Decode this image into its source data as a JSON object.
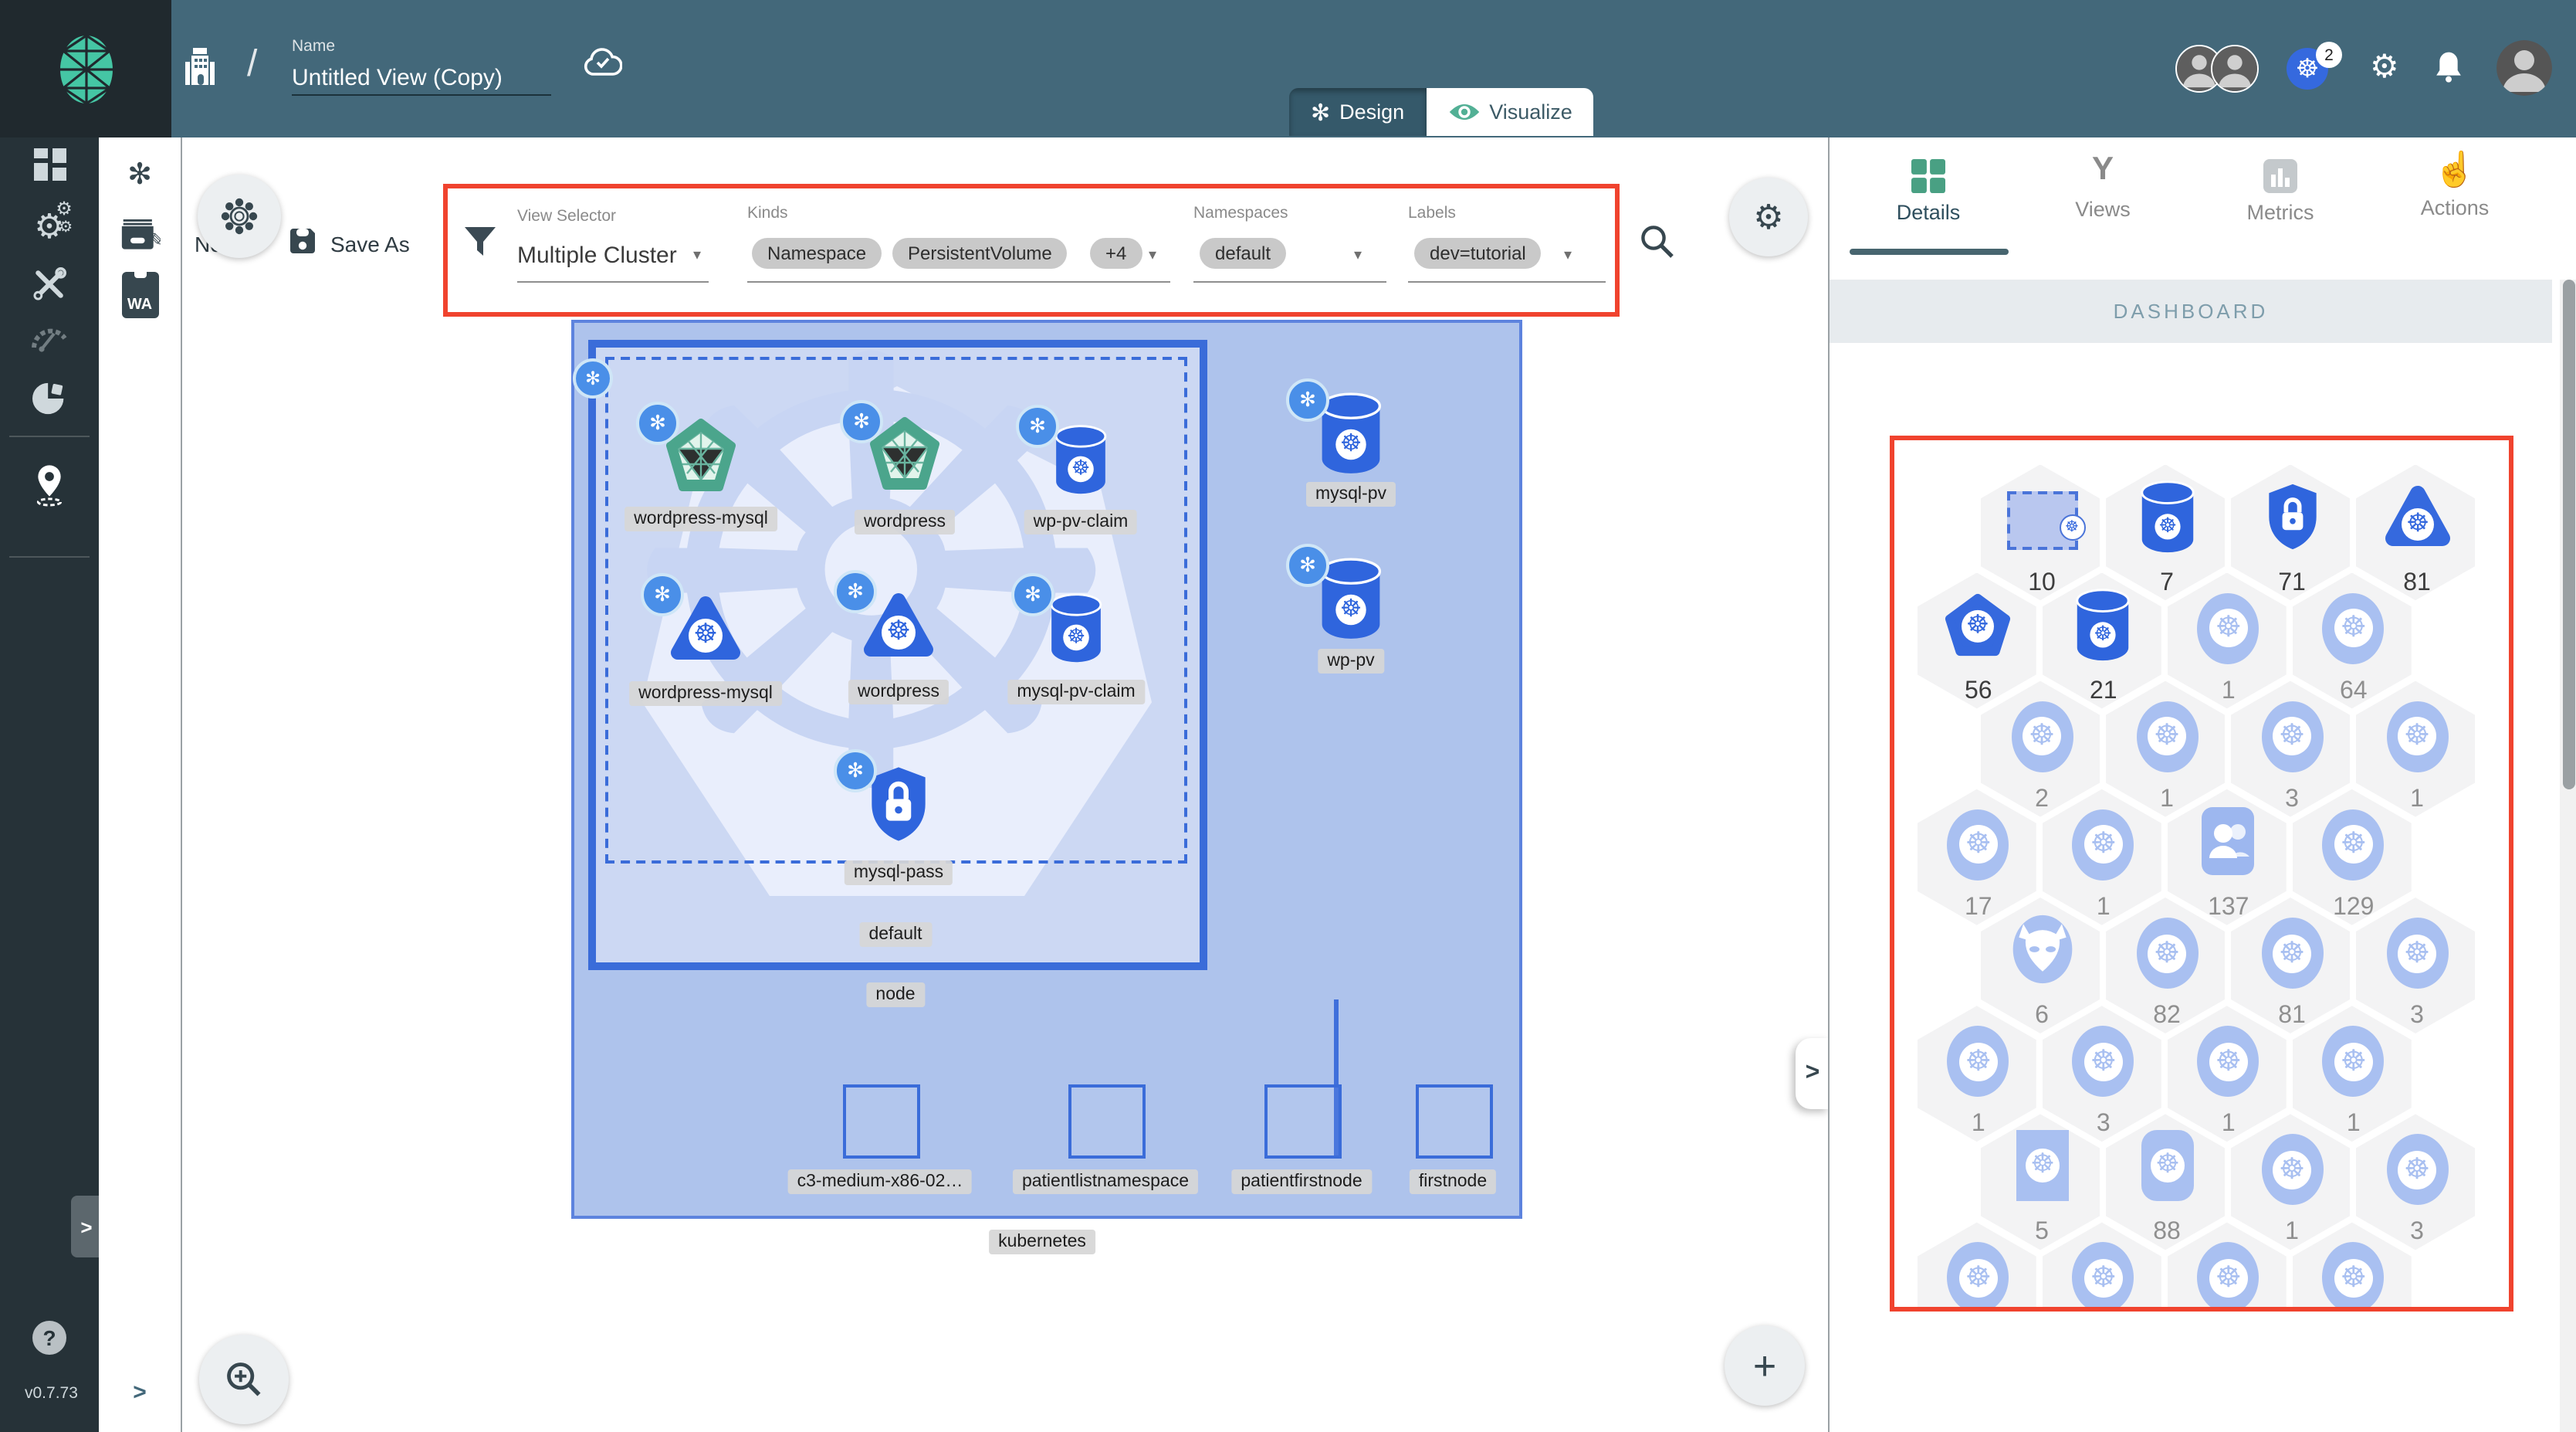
{
  "header": {
    "name_label": "Name",
    "name_value": "Untitled View (Copy)",
    "design_label": "Design",
    "visualize_label": "Visualize",
    "k8s_context_badge": "2"
  },
  "sidebar": {
    "version": "v0.7.73",
    "help": "?"
  },
  "toolbar": {
    "new_label": "New",
    "save_as_label": "Save As",
    "view_selector_label": "View Selector",
    "view_selector_value": "Multiple Cluster",
    "kinds_label": "Kinds",
    "kinds_chips": [
      "Namespace",
      "PersistentVolume",
      "+4"
    ],
    "namespaces_label": "Namespaces",
    "namespaces_chips": [
      "default"
    ],
    "labels_label": "Labels",
    "labels_chips": [
      "dev=tutorial"
    ]
  },
  "panel": {
    "tabs": [
      {
        "label": "Details",
        "active": true
      },
      {
        "label": "Views",
        "active": false
      },
      {
        "label": "Metrics",
        "active": false
      },
      {
        "label": "Actions",
        "active": false
      }
    ],
    "section_title": "DASHBOARD",
    "hex_rows": [
      {
        "offset": true,
        "cells": [
          {
            "icon": "namespace",
            "count": "10",
            "strong": true
          },
          {
            "icon": "storage",
            "count": "7",
            "strong": true
          },
          {
            "icon": "secret",
            "count": "71",
            "strong": true
          },
          {
            "icon": "blob",
            "count": "81",
            "strong": true
          }
        ]
      },
      {
        "offset": false,
        "cells": [
          {
            "icon": "pentagon",
            "count": "56",
            "strong": true
          },
          {
            "icon": "storage",
            "count": "21",
            "strong": true
          },
          {
            "icon": "circle",
            "count": "1",
            "strong": false
          },
          {
            "icon": "circle",
            "count": "64",
            "strong": false
          }
        ]
      },
      {
        "offset": true,
        "cells": [
          {
            "icon": "circle",
            "count": "2",
            "strong": false
          },
          {
            "icon": "circle",
            "count": "1",
            "strong": false
          },
          {
            "icon": "circle",
            "count": "3",
            "strong": false
          },
          {
            "icon": "circle",
            "count": "1",
            "strong": false
          }
        ]
      },
      {
        "offset": false,
        "cells": [
          {
            "icon": "circle",
            "count": "17",
            "strong": false
          },
          {
            "icon": "circle",
            "count": "1",
            "strong": false
          },
          {
            "icon": "person",
            "count": "137",
            "strong": false
          },
          {
            "icon": "circle",
            "count": "129",
            "strong": false
          }
        ]
      },
      {
        "offset": true,
        "cells": [
          {
            "icon": "devil",
            "count": "6",
            "strong": false
          },
          {
            "icon": "circle",
            "count": "82",
            "strong": false
          },
          {
            "icon": "circle",
            "count": "81",
            "strong": false
          },
          {
            "icon": "circle",
            "count": "3",
            "strong": false
          }
        ]
      },
      {
        "offset": false,
        "cells": [
          {
            "icon": "circle",
            "count": "1",
            "strong": false
          },
          {
            "icon": "circle",
            "count": "3",
            "strong": false
          },
          {
            "icon": "circle",
            "count": "1",
            "strong": false
          },
          {
            "icon": "circle",
            "count": "1",
            "strong": false
          }
        ]
      },
      {
        "offset": true,
        "cells": [
          {
            "icon": "rect",
            "count": "5",
            "strong": false
          },
          {
            "icon": "roundsq",
            "count": "88",
            "strong": false
          },
          {
            "icon": "circle",
            "count": "1",
            "strong": false
          },
          {
            "icon": "circle",
            "count": "3",
            "strong": false
          }
        ]
      },
      {
        "offset": false,
        "cells": [
          {
            "icon": "circle",
            "count": "",
            "strong": false
          },
          {
            "icon": "circle",
            "count": "",
            "strong": false
          },
          {
            "icon": "circle",
            "count": "",
            "strong": false
          },
          {
            "icon": "circle",
            "count": "",
            "strong": false
          }
        ]
      }
    ]
  },
  "canvas": {
    "cluster_label": "kubernetes",
    "node_label": "node",
    "namespace_label": "default",
    "nodes": [
      {
        "type": "service",
        "label": "wordpress-mysql"
      },
      {
        "type": "service",
        "label": "wordpress"
      },
      {
        "type": "pvc",
        "label": "wp-pv-claim"
      },
      {
        "type": "deploy",
        "label": "wordpress-mysql"
      },
      {
        "type": "deploy",
        "label": "wordpress"
      },
      {
        "type": "pvc",
        "label": "mysql-pv-claim"
      },
      {
        "type": "secret",
        "label": "mysql-pass"
      },
      {
        "type": "pv",
        "label": "mysql-pv"
      },
      {
        "type": "pv",
        "label": "wp-pv"
      }
    ],
    "hosts": [
      {
        "label": "c3-medium-x86-02…"
      },
      {
        "label": "patientlistnamespace"
      },
      {
        "label": "patientfirstnode"
      },
      {
        "label": "firstnode"
      }
    ]
  }
}
